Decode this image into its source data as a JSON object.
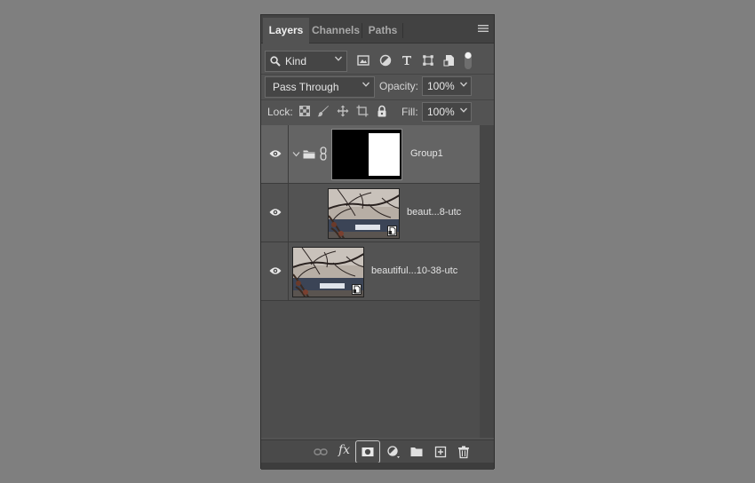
{
  "tabs": [
    {
      "label": "Layers",
      "active": true
    },
    {
      "label": "Channels",
      "active": false
    },
    {
      "label": "Paths",
      "active": false
    }
  ],
  "filter": {
    "kind_label": "Kind",
    "icons": [
      "image-filter-icon",
      "adjustment-filter-icon",
      "type-filter-icon",
      "shape-filter-icon",
      "smart-object-filter-icon",
      "filter-toggle"
    ]
  },
  "blend": {
    "mode": "Pass Through",
    "opacity_label": "Opacity:",
    "opacity_value": "100%"
  },
  "lock": {
    "label": "Lock:",
    "fill_label": "Fill:",
    "fill_value": "100%",
    "icons": [
      "lock-transparent-pixels-icon",
      "lock-image-pixels-icon",
      "lock-position-icon",
      "artboard-lock-icon",
      "lock-all-icon"
    ]
  },
  "layers": [
    {
      "name": "Group1",
      "type": "group",
      "visible": true,
      "selected": true
    },
    {
      "name": "beaut...8-utc",
      "type": "smart-object",
      "visible": true,
      "selected": false
    },
    {
      "name": "beautiful...10-38-utc",
      "type": "smart-object",
      "visible": true,
      "selected": false
    }
  ],
  "bottom_bar": {
    "icons": [
      "link-layers-icon",
      "fx-icon",
      "add-mask-icon",
      "adjustment-layer-icon",
      "new-group-icon",
      "new-layer-icon",
      "trash-icon"
    ],
    "fx_label": "fx"
  },
  "colors": {
    "panel_bg": "#535353",
    "selected_row": "#646464",
    "page_bg": "#7f7f7f"
  }
}
